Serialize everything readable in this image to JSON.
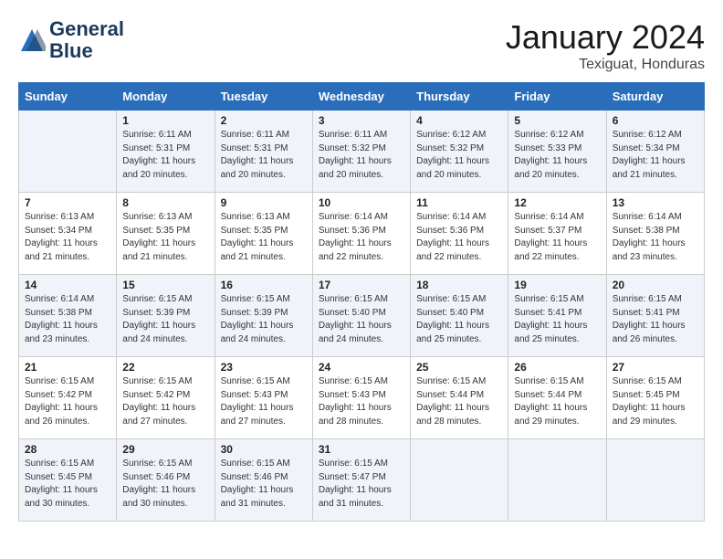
{
  "header": {
    "logo_line1": "General",
    "logo_line2": "Blue",
    "month": "January 2024",
    "location": "Texiguat, Honduras"
  },
  "days_of_week": [
    "Sunday",
    "Monday",
    "Tuesday",
    "Wednesday",
    "Thursday",
    "Friday",
    "Saturday"
  ],
  "weeks": [
    [
      {
        "day": "",
        "sunrise": "",
        "sunset": "",
        "daylight": ""
      },
      {
        "day": "1",
        "sunrise": "6:11 AM",
        "sunset": "5:31 PM",
        "daylight": "11 hours and 20 minutes."
      },
      {
        "day": "2",
        "sunrise": "6:11 AM",
        "sunset": "5:31 PM",
        "daylight": "11 hours and 20 minutes."
      },
      {
        "day": "3",
        "sunrise": "6:11 AM",
        "sunset": "5:32 PM",
        "daylight": "11 hours and 20 minutes."
      },
      {
        "day": "4",
        "sunrise": "6:12 AM",
        "sunset": "5:32 PM",
        "daylight": "11 hours and 20 minutes."
      },
      {
        "day": "5",
        "sunrise": "6:12 AM",
        "sunset": "5:33 PM",
        "daylight": "11 hours and 20 minutes."
      },
      {
        "day": "6",
        "sunrise": "6:12 AM",
        "sunset": "5:34 PM",
        "daylight": "11 hours and 21 minutes."
      }
    ],
    [
      {
        "day": "7",
        "sunrise": "6:13 AM",
        "sunset": "5:34 PM",
        "daylight": "11 hours and 21 minutes."
      },
      {
        "day": "8",
        "sunrise": "6:13 AM",
        "sunset": "5:35 PM",
        "daylight": "11 hours and 21 minutes."
      },
      {
        "day": "9",
        "sunrise": "6:13 AM",
        "sunset": "5:35 PM",
        "daylight": "11 hours and 21 minutes."
      },
      {
        "day": "10",
        "sunrise": "6:14 AM",
        "sunset": "5:36 PM",
        "daylight": "11 hours and 22 minutes."
      },
      {
        "day": "11",
        "sunrise": "6:14 AM",
        "sunset": "5:36 PM",
        "daylight": "11 hours and 22 minutes."
      },
      {
        "day": "12",
        "sunrise": "6:14 AM",
        "sunset": "5:37 PM",
        "daylight": "11 hours and 22 minutes."
      },
      {
        "day": "13",
        "sunrise": "6:14 AM",
        "sunset": "5:38 PM",
        "daylight": "11 hours and 23 minutes."
      }
    ],
    [
      {
        "day": "14",
        "sunrise": "6:14 AM",
        "sunset": "5:38 PM",
        "daylight": "11 hours and 23 minutes."
      },
      {
        "day": "15",
        "sunrise": "6:15 AM",
        "sunset": "5:39 PM",
        "daylight": "11 hours and 24 minutes."
      },
      {
        "day": "16",
        "sunrise": "6:15 AM",
        "sunset": "5:39 PM",
        "daylight": "11 hours and 24 minutes."
      },
      {
        "day": "17",
        "sunrise": "6:15 AM",
        "sunset": "5:40 PM",
        "daylight": "11 hours and 24 minutes."
      },
      {
        "day": "18",
        "sunrise": "6:15 AM",
        "sunset": "5:40 PM",
        "daylight": "11 hours and 25 minutes."
      },
      {
        "day": "19",
        "sunrise": "6:15 AM",
        "sunset": "5:41 PM",
        "daylight": "11 hours and 25 minutes."
      },
      {
        "day": "20",
        "sunrise": "6:15 AM",
        "sunset": "5:41 PM",
        "daylight": "11 hours and 26 minutes."
      }
    ],
    [
      {
        "day": "21",
        "sunrise": "6:15 AM",
        "sunset": "5:42 PM",
        "daylight": "11 hours and 26 minutes."
      },
      {
        "day": "22",
        "sunrise": "6:15 AM",
        "sunset": "5:42 PM",
        "daylight": "11 hours and 27 minutes."
      },
      {
        "day": "23",
        "sunrise": "6:15 AM",
        "sunset": "5:43 PM",
        "daylight": "11 hours and 27 minutes."
      },
      {
        "day": "24",
        "sunrise": "6:15 AM",
        "sunset": "5:43 PM",
        "daylight": "11 hours and 28 minutes."
      },
      {
        "day": "25",
        "sunrise": "6:15 AM",
        "sunset": "5:44 PM",
        "daylight": "11 hours and 28 minutes."
      },
      {
        "day": "26",
        "sunrise": "6:15 AM",
        "sunset": "5:44 PM",
        "daylight": "11 hours and 29 minutes."
      },
      {
        "day": "27",
        "sunrise": "6:15 AM",
        "sunset": "5:45 PM",
        "daylight": "11 hours and 29 minutes."
      }
    ],
    [
      {
        "day": "28",
        "sunrise": "6:15 AM",
        "sunset": "5:45 PM",
        "daylight": "11 hours and 30 minutes."
      },
      {
        "day": "29",
        "sunrise": "6:15 AM",
        "sunset": "5:46 PM",
        "daylight": "11 hours and 30 minutes."
      },
      {
        "day": "30",
        "sunrise": "6:15 AM",
        "sunset": "5:46 PM",
        "daylight": "11 hours and 31 minutes."
      },
      {
        "day": "31",
        "sunrise": "6:15 AM",
        "sunset": "5:47 PM",
        "daylight": "11 hours and 31 minutes."
      },
      {
        "day": "",
        "sunrise": "",
        "sunset": "",
        "daylight": ""
      },
      {
        "day": "",
        "sunrise": "",
        "sunset": "",
        "daylight": ""
      },
      {
        "day": "",
        "sunrise": "",
        "sunset": "",
        "daylight": ""
      }
    ]
  ]
}
